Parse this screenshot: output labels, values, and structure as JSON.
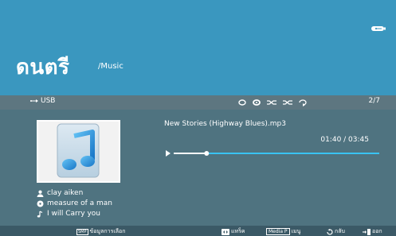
{
  "header": {
    "title": "ดนตรี",
    "subtitle": "/Music"
  },
  "status_bar": {
    "source_label": "USB",
    "mode_icons": [
      "repeat-icon",
      "repeat-one-icon",
      "shuffle-icon",
      "shuffle-off-icon",
      "repeat-off-icon"
    ],
    "track_count": "2/7"
  },
  "player": {
    "track_name": "New Stories (Highway Blues).mp3",
    "time": "01:40 / 03:45",
    "progress_fraction": 0.16,
    "artist": "clay aiken",
    "album": "measure of a man",
    "song": "I will Carry you"
  },
  "footer": {
    "item1_badge": "SMP",
    "item1_label": "ข้อมูลการเลือก",
    "item2_label": "แทร็ค",
    "item3_badge": "Media P",
    "item3_label": "เมนู",
    "item4_label": "กลับ",
    "item5_label": "ออก"
  },
  "colors": {
    "header": "#3a97bf",
    "accent": "#39c3f2",
    "panel": "#4f7380"
  }
}
